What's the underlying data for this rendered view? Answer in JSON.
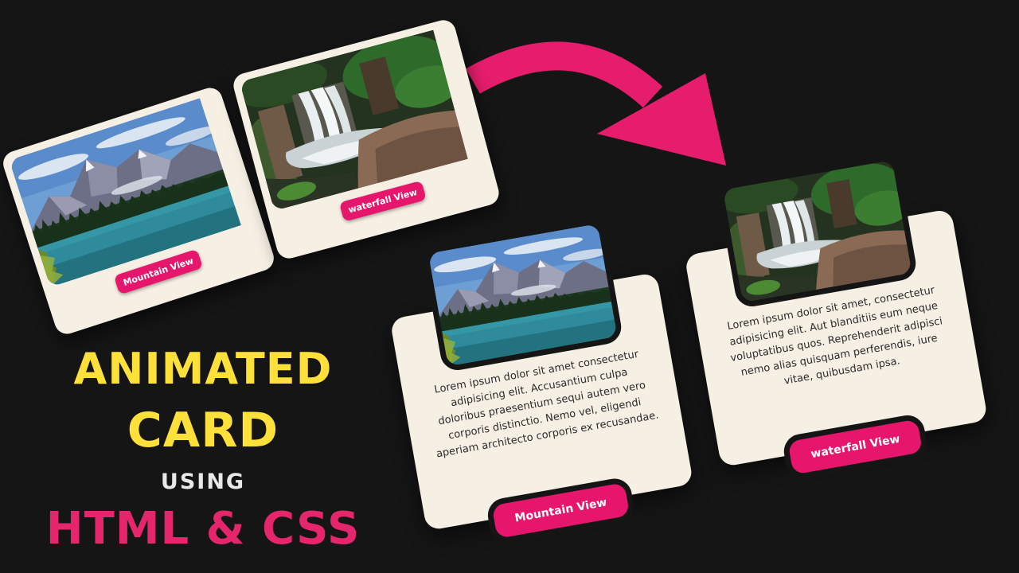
{
  "title": {
    "line1": "ANIMATED",
    "line2": "CARD",
    "line3": "USING",
    "line4": "HTML & CSS"
  },
  "cards": {
    "mountain_small": {
      "button_label": "Mountain View"
    },
    "waterfall_small": {
      "button_label": "waterfall View"
    },
    "mountain_big": {
      "button_label": "Mountain View",
      "text": "Lorem ipsum dolor sit amet consectetur adipisicing elit. Accusantium culpa doloribus praesentium sequi autem vero corporis distinctio. Nemo vel, eligendi aperiam architecto corporis ex recusandae."
    },
    "waterfall_big": {
      "button_label": "waterfall View",
      "text": "Lorem ipsum dolor sit amet, consectetur adipisicing elit. Aut blanditiis eum neque voluptatibus quos. Reprehenderit adipisci nemo alias quisquam perferendis, iure vitae, quibusdam ipsa."
    }
  },
  "colors": {
    "background": "#151515",
    "card": "#f6efe4",
    "accent_pink": "#e6166c",
    "title_yellow": "#fde03a"
  }
}
